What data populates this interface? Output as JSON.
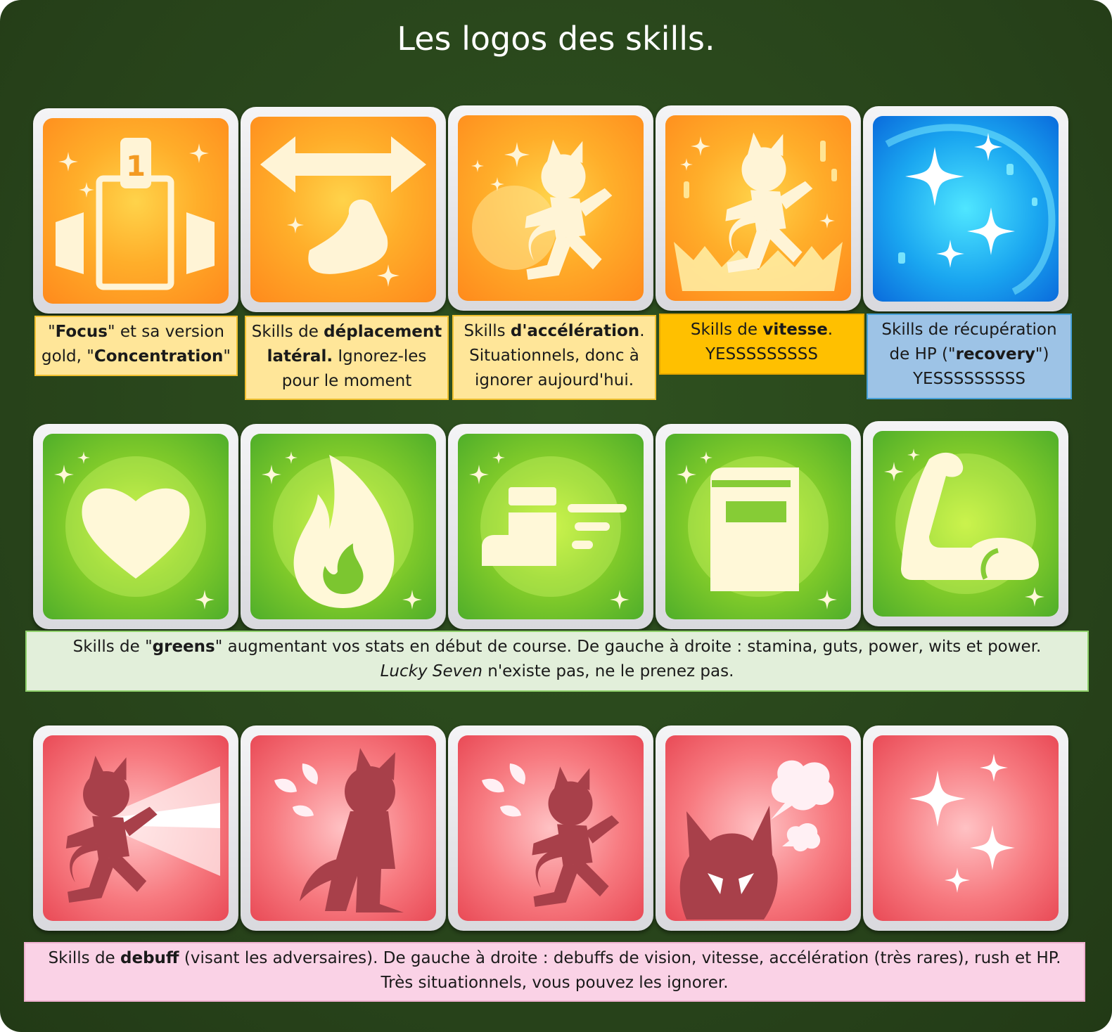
{
  "title": "Les logos des skills.",
  "rows": [
    {
      "tiles": [
        {
          "icon": "focus-icon",
          "color": "orange"
        },
        {
          "icon": "lateral-move-icon",
          "color": "orange"
        },
        {
          "icon": "acceleration-icon",
          "color": "orange"
        },
        {
          "icon": "speed-icon",
          "color": "orange"
        },
        {
          "icon": "recovery-icon",
          "color": "blue"
        }
      ],
      "captions": [
        {
          "l1a": "\"",
          "l1b": "Focus",
          "l1c": "\" et sa version",
          "l2a": "gold, \"",
          "l2b": "Concentration",
          "l2c": "\""
        },
        {
          "l1a": "Skills de ",
          "l1b": "déplacement",
          "l2b": "latéral.",
          "l2c": " Ignorez-les",
          "l3": "pour le moment"
        },
        {
          "l1a": "Skills ",
          "l1b": "d'accélération",
          "l1c": ".",
          "l2": "Situationnels, donc à",
          "l3": "ignorer aujourd'hui."
        },
        {
          "l1a": "Skills de ",
          "l1b": "vitesse",
          "l1c": ".",
          "l2": "YESSSSSSSSS"
        },
        {
          "l1": "Skills de récupération",
          "l2a": "de HP (\"",
          "l2b": "recovery",
          "l2c": "\")",
          "l3": "YESSSSSSSSS"
        }
      ]
    },
    {
      "tiles": [
        {
          "icon": "heart-icon",
          "color": "green"
        },
        {
          "icon": "flame-icon",
          "color": "green"
        },
        {
          "icon": "boot-icon",
          "color": "green"
        },
        {
          "icon": "book-icon",
          "color": "green"
        },
        {
          "icon": "muscle-arm-icon",
          "color": "green"
        }
      ],
      "caption": {
        "l1a": "Skills de \"",
        "l1b": "greens",
        "l1c": "\" augmentant vos stats en début de course. De gauche à droite : stamina, guts, power, wits et power.",
        "l2a": "Lucky Seven",
        "l2b": " n'existe pas, ne le prenez pas."
      }
    },
    {
      "tiles": [
        {
          "icon": "vision-debuff-icon",
          "color": "red"
        },
        {
          "icon": "speed-debuff-icon",
          "color": "red"
        },
        {
          "icon": "acceleration-debuff-icon",
          "color": "red"
        },
        {
          "icon": "rush-debuff-icon",
          "color": "red"
        },
        {
          "icon": "hp-debuff-icon",
          "color": "red"
        }
      ],
      "caption": {
        "l1a": "Skills de ",
        "l1b": "debuff",
        "l1c": " (visant les adversaires). De gauche à droite : debuffs de vision, vitesse, accélération (très rares), rush et HP.",
        "l2": "Très situationnels, vous pouvez les ignorer."
      }
    }
  ]
}
